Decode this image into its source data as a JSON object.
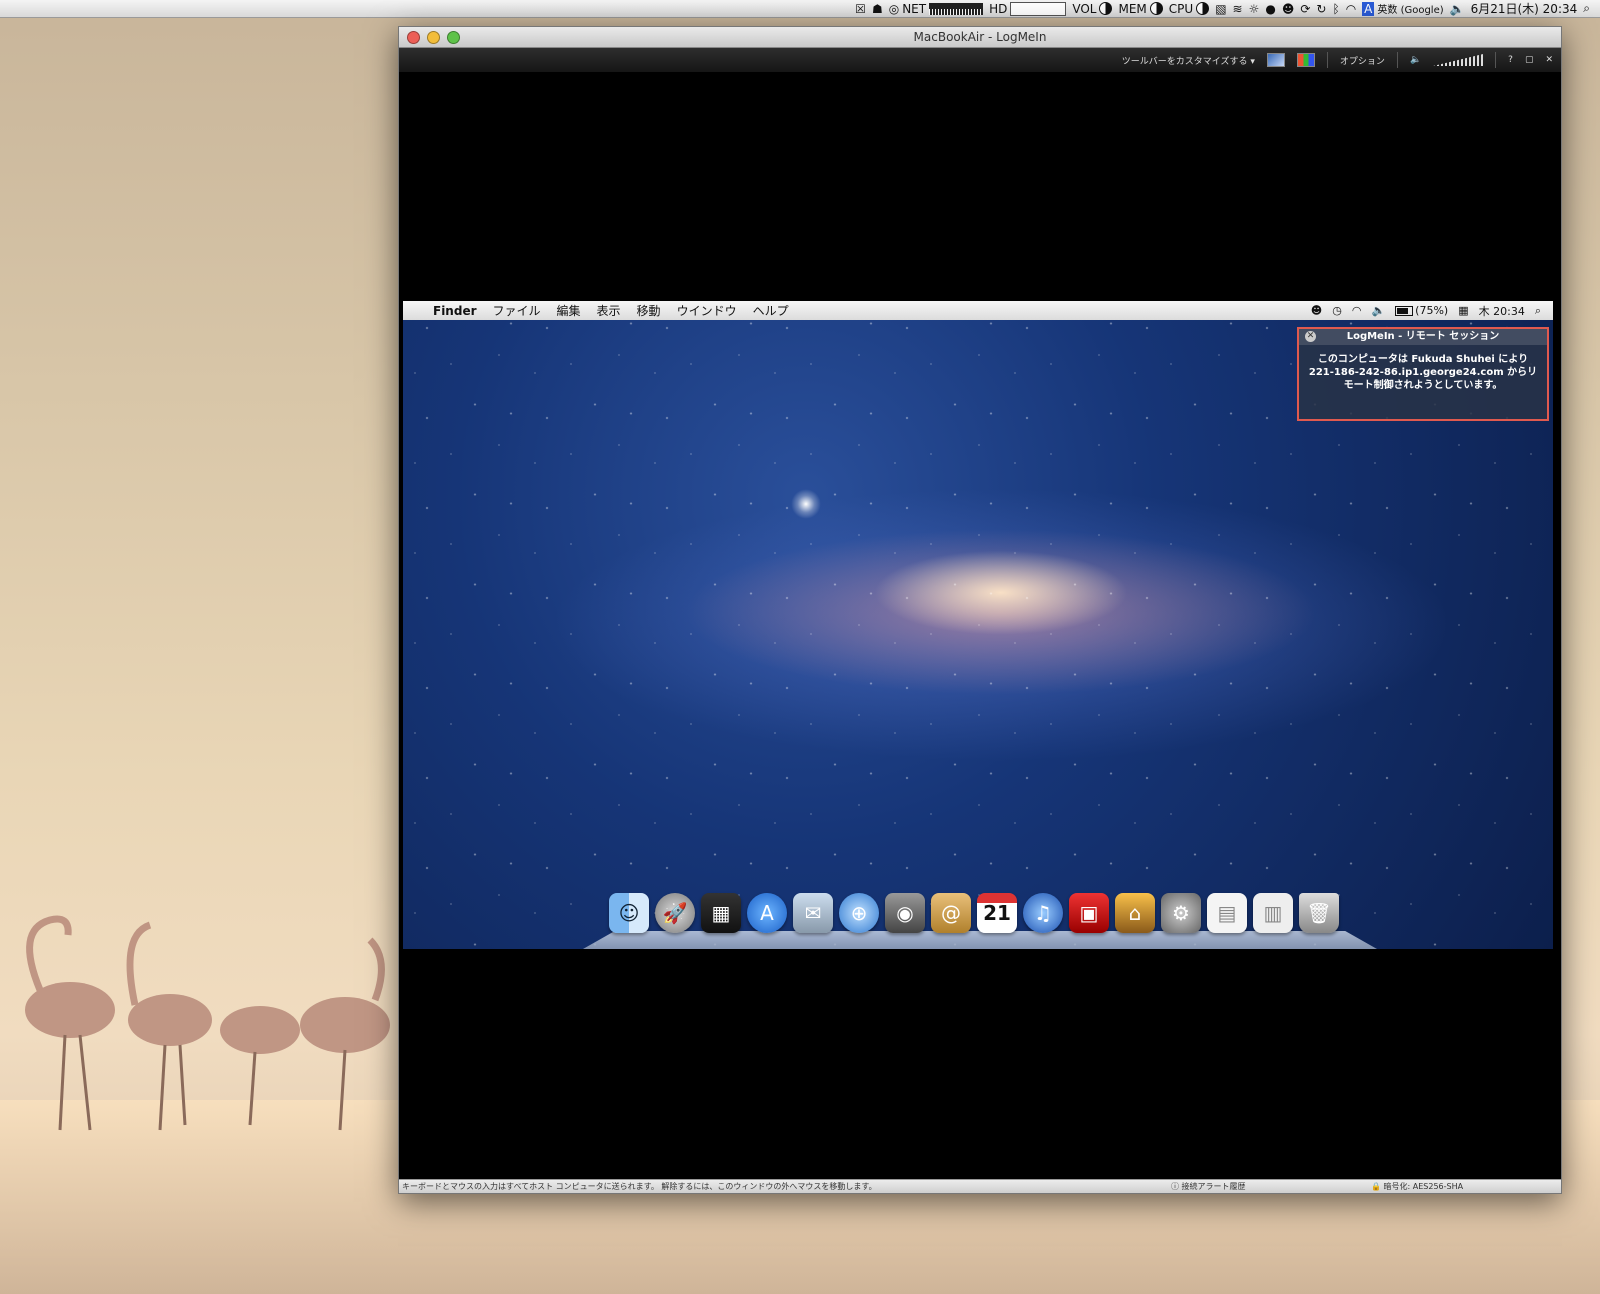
{
  "host_menubar": {
    "net": "NET",
    "hd": "HD",
    "vol": "VOL",
    "mem": "MEM",
    "cpu": "CPU",
    "input_method": "英数 (Google)",
    "datetime": "6月21日(木) 20:34"
  },
  "window": {
    "title": "MacBookAir - LogMeIn",
    "toolbar": {
      "customize": "ツールバーをカスタマイズする",
      "options": "オプション"
    }
  },
  "remote": {
    "menus": [
      "Finder",
      "ファイル",
      "編集",
      "表示",
      "移動",
      "ウインドウ",
      "ヘルプ"
    ],
    "battery": "(75%)",
    "clock": "木 20:34",
    "notice": {
      "title": "LogMeIn - リモート セッション",
      "body_line1": "このコンピュータは Fukuda Shuhei により",
      "body_line2": "221-186-242-86.ip1.george24.com からリ",
      "body_line3": "モート制御されようとしています。"
    },
    "dock_calendar_day": "21"
  },
  "statusbar": {
    "message": "キーボードとマウスの入力はすべてホスト コンピュータに送られます。 解除するには、このウィンドウの外へマウスを移動します。",
    "alerts": "接続アラート履歴",
    "encryption": "暗号化: AES256-SHA"
  }
}
